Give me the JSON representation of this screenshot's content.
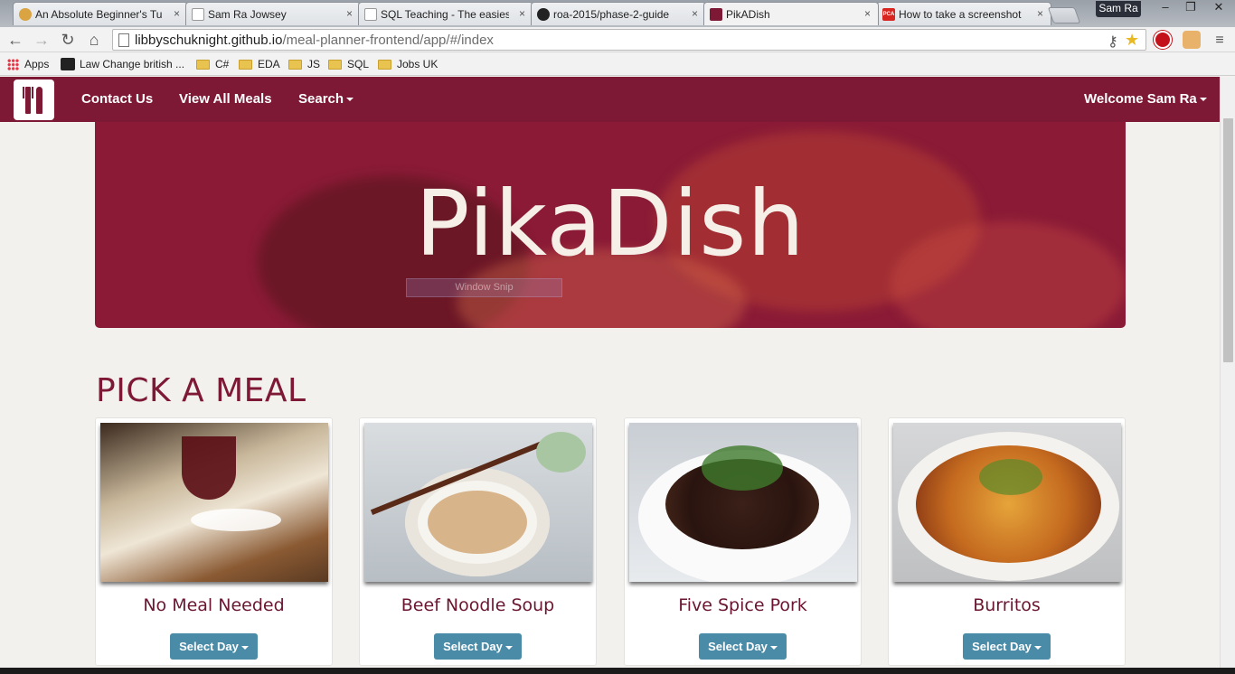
{
  "browser": {
    "tabs": [
      {
        "title": "An Absolute Beginner's Tu",
        "favicon_color": "#d9a441"
      },
      {
        "title": "Sam Ra Jowsey",
        "favicon_color": "#ffffff"
      },
      {
        "title": "SQL Teaching - The easies",
        "favicon_color": "#ffffff"
      },
      {
        "title": "roa-2015/phase-2-guide",
        "favicon_color": "#222222"
      },
      {
        "title": "PikADish",
        "favicon_color": "#7d1835"
      },
      {
        "title": "How to take a screenshot",
        "favicon_color": "#d8251f",
        "favicon_text": "PCA"
      }
    ],
    "tab_close": "×",
    "profile_name": "Sam Ra",
    "window_controls": {
      "minimize": "–",
      "restore": "❐",
      "close": "✕"
    },
    "nav": {
      "back": "←",
      "forward": "→",
      "reload": "↻",
      "home": "⌂"
    },
    "url_host": "libbyschuknight.github.io",
    "url_path": "/meal-planner-frontend/app/#/index",
    "bookmarks": [
      {
        "label": "Apps",
        "type": "apps"
      },
      {
        "label": "Law Change british ...",
        "type": "site"
      },
      {
        "label": "C#",
        "type": "folder"
      },
      {
        "label": "EDA",
        "type": "folder"
      },
      {
        "label": "JS",
        "type": "folder"
      },
      {
        "label": "SQL",
        "type": "folder"
      },
      {
        "label": "Jobs UK",
        "type": "folder"
      }
    ]
  },
  "site": {
    "brand_color": "#7d1835",
    "nav": {
      "contact": "Contact Us",
      "view_all": "View All Meals",
      "search": "Search",
      "welcome": "Welcome Sam Ra"
    },
    "hero": {
      "title": "PikaDish",
      "overlay_label": "Window Snip"
    },
    "section_title": "PICK A MEAL",
    "meals": [
      {
        "name": "No Meal Needed",
        "button": "Select Day"
      },
      {
        "name": "Beef Noodle Soup",
        "button": "Select Day"
      },
      {
        "name": "Five Spice Pork",
        "button": "Select Day"
      },
      {
        "name": "Burritos",
        "button": "Select Day"
      }
    ],
    "button_color": "#4a8ba8"
  }
}
